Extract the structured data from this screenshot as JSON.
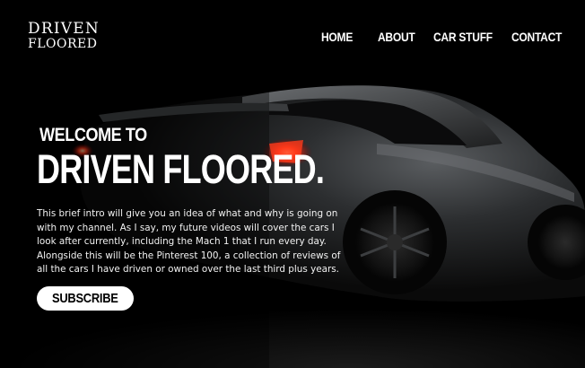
{
  "brand": {
    "line1": "DRIVEN",
    "line2": "FLOORED"
  },
  "nav": {
    "items": [
      "HOME",
      "ABOUT",
      "CAR STUFF",
      "CONTACT"
    ]
  },
  "hero": {
    "welcome": "WELCOME TO",
    "title": "DRIVEN FLOORED.",
    "intro": "This brief intro will give you an idea of what and why is going on with my channel. As I say, my future videos will cover the cars I look after currently, including the Mach 1 that I run every day. Alongside this will be the Pinterest 100, a collection of reviews of all the cars I have driven or owned over the last third plus years.",
    "cta_label": "SUBSCRIBE"
  },
  "colors": {
    "background": "#000000",
    "text": "#ffffff",
    "button_bg": "#ffffff",
    "button_text": "#000000",
    "taillight": "#ff3a1a"
  }
}
